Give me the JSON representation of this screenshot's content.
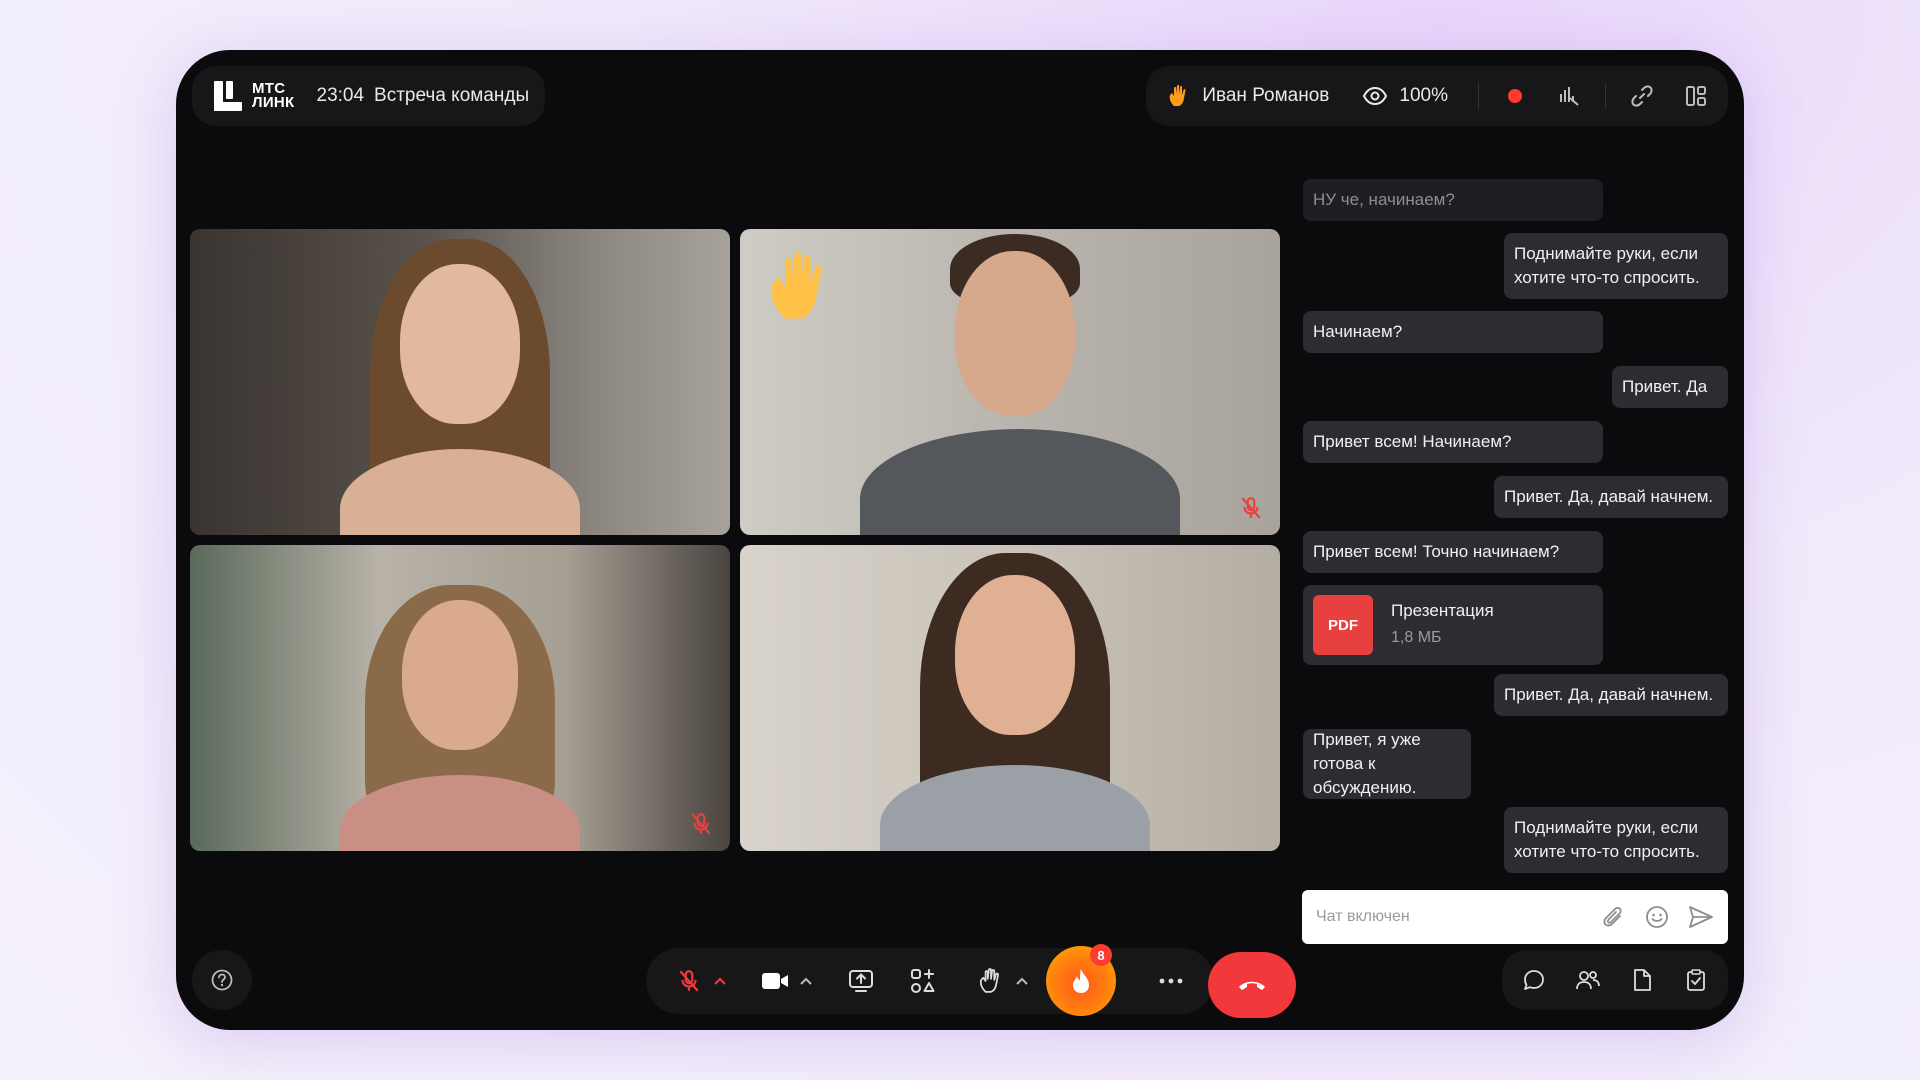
{
  "app": {
    "logo_line1": "МТС",
    "logo_line2": "ЛИНК",
    "time": "23:04",
    "meeting_title": "Встреча команды"
  },
  "header": {
    "presenter_name": "Иван Романов",
    "zoom": "100%",
    "icons": [
      "raised-hand-icon",
      "eye-icon",
      "record-indicator-icon",
      "audio-levels-icon",
      "link-icon",
      "layout-icon"
    ]
  },
  "colors": {
    "accent_red": "#f2383a",
    "record": "#ff3b30",
    "pdf": "#e8403f",
    "reaction_orange": "#ff7a10"
  },
  "chat": {
    "messages": [
      {
        "text": "НУ че, начинаем?",
        "side": "left"
      },
      {
        "text": "Поднимайте руки, если хотите что-то спросить.",
        "side": "right"
      },
      {
        "text": "Начинаем?",
        "side": "left"
      },
      {
        "text": "Привет. Да",
        "side": "right"
      },
      {
        "text": "Привет всем! Начинаем?",
        "side": "left"
      },
      {
        "text": "Привет. Да, давай начнем.",
        "side": "right"
      },
      {
        "text": "Привет всем! Точно начинаем?",
        "side": "left"
      },
      {
        "text": "Привет. Да, давай начнем.",
        "side": "right"
      },
      {
        "text": "Привет, я уже готова к обсуждению.",
        "side": "left"
      },
      {
        "text": "Поднимайте руки, если хотите что-то спросить.",
        "side": "right"
      }
    ],
    "file": {
      "badge": "PDF",
      "name": "Презентация",
      "size": "1,8 МБ"
    },
    "input_placeholder": "Чат включен"
  },
  "controls": {
    "reactions_count": "8"
  }
}
